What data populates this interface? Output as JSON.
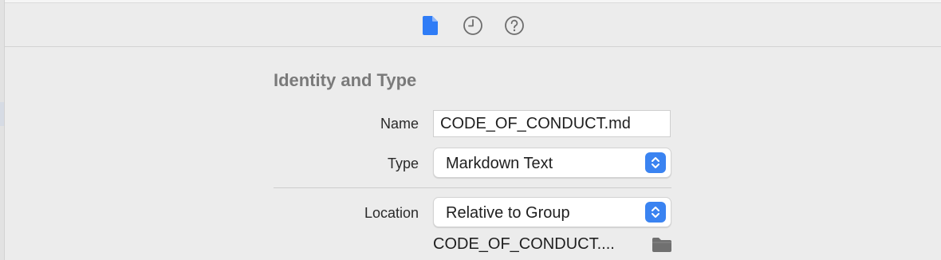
{
  "toolbar": {
    "tabs": [
      {
        "name": "file-inspector",
        "icon": "document-icon",
        "active": true,
        "color": "#2f7cf6"
      },
      {
        "name": "history-inspector",
        "icon": "clock-icon",
        "active": false,
        "color": "#6d6d6d"
      },
      {
        "name": "quick-help-inspector",
        "icon": "question-circle-icon",
        "active": false,
        "color": "#6d6d6d"
      }
    ]
  },
  "identity": {
    "section_title": "Identity and Type",
    "name_label": "Name",
    "name_value": "CODE_OF_CONDUCT.md",
    "type_label": "Type",
    "type_value": "Markdown Text",
    "location_label": "Location",
    "location_value": "Relative to Group",
    "path_value": "CODE_OF_CONDUCT....",
    "folder_icon": "folder-icon"
  },
  "colors": {
    "accent": "#3a83f1",
    "background": "#ececec",
    "section_title": "#7a7a7a"
  }
}
